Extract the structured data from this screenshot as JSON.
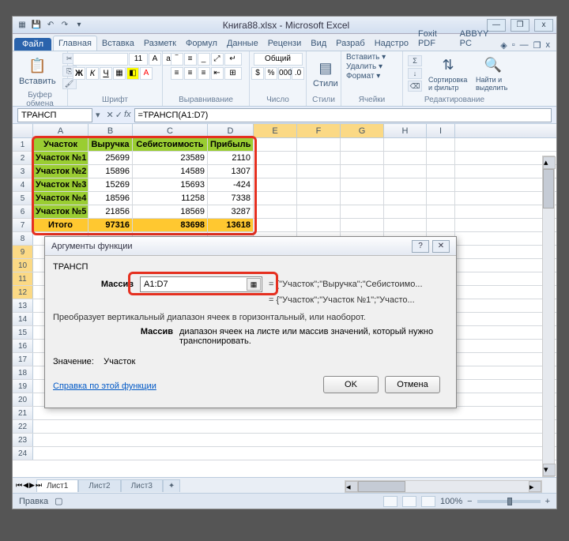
{
  "title": "Книга88.xlsx - Microsoft Excel",
  "qat": {
    "save": "💾",
    "undo": "↶",
    "redo": "↷",
    "dd": "▾"
  },
  "tabs": {
    "file": "Файл",
    "home": "Главная",
    "insert": "Вставка",
    "layout": "Разметк",
    "formulas": "Формул",
    "data": "Данные",
    "review": "Рецензи",
    "view": "Вид",
    "dev": "Разраб",
    "addins": "Надстро",
    "foxit": "Foxit PDF",
    "abbyy": "ABBYY PC"
  },
  "ribbon_help": {
    "help": "◈",
    "min": "▾",
    "winmin": "—",
    "winmax": "❐",
    "winclose": "x"
  },
  "groups": {
    "clipboard": {
      "label": "Буфер обмена",
      "paste": "Вставить",
      "paste_dd": "▾"
    },
    "font": {
      "label": "Шрифт"
    },
    "align": {
      "label": "Выравнивание"
    },
    "number": {
      "label": "Число",
      "general": "Общий"
    },
    "styles": {
      "label": "Стили",
      "styles_btn": "Стили"
    },
    "cells": {
      "label": "Ячейки",
      "insert": "Вставить ▾",
      "delete": "Удалить ▾",
      "format": "Формат ▾"
    },
    "editing": {
      "label": "Редактирование",
      "sort": "Сортировка и фильтр",
      "find": "Найти и выделить"
    }
  },
  "namebox": "ТРАНСП",
  "fx": {
    "cancel": "✕",
    "enter": "✓",
    "fx": "fx"
  },
  "formula": "=ТРАНСП(A1:D7)",
  "cols": [
    "A",
    "B",
    "C",
    "D",
    "E",
    "F",
    "G",
    "H",
    "I"
  ],
  "table": {
    "headers": [
      "Участок",
      "Выручка",
      "Себистоимость",
      "Прибыль"
    ],
    "rows": [
      {
        "name": "Участок №1",
        "rev": "25699",
        "cost": "23589",
        "profit": "2110"
      },
      {
        "name": "Участок №2",
        "rev": "15896",
        "cost": "14589",
        "profit": "1307"
      },
      {
        "name": "Участок №3",
        "rev": "15269",
        "cost": "15693",
        "profit": "-424"
      },
      {
        "name": "Участок №4",
        "rev": "18596",
        "cost": "11258",
        "profit": "7338"
      },
      {
        "name": "Участок №5",
        "rev": "21856",
        "cost": "18569",
        "profit": "3287"
      }
    ],
    "total": {
      "name": "Итого",
      "rev": "97316",
      "cost": "83698",
      "profit": "13618"
    }
  },
  "dialog": {
    "title": "Аргументы функции",
    "func": "ТРАНСП",
    "arg_label": "Массив",
    "arg_value": "A1:D7",
    "arg_preview": "= {\"Участок\";\"Выручка\";\"Себистоимо...",
    "result_preview": "= {\"Участок\";\"Участок №1\";\"Участо...",
    "desc": "Преобразует вертикальный диапазон ячеек в горизонтальный, или наоборот.",
    "arg_desc_label": "Массив",
    "arg_desc": "диапазон ячеек на листе или массив значений, который нужно транспонировать.",
    "value_label": "Значение:",
    "value": "Участок",
    "help": "Справка по этой функции",
    "ok": "OK",
    "cancel": "Отмена"
  },
  "sheets": [
    "Лист1",
    "Лист2",
    "Лист3"
  ],
  "status": {
    "mode": "Правка",
    "zoom": "100%"
  }
}
